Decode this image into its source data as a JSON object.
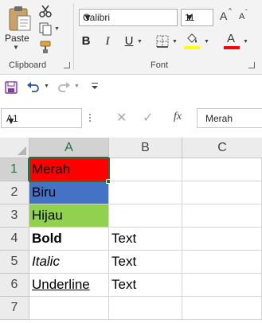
{
  "ribbon": {
    "clipboard": {
      "paste_label": "Paste",
      "group_label": "Clipboard",
      "icons": [
        "clipboard-paste-icon",
        "cut-icon",
        "copy-icon",
        "format-painter-icon"
      ]
    },
    "font": {
      "group_label": "Font",
      "font_name": "Calibri",
      "font_size": "11",
      "grow_label": "A",
      "shrink_label": "A",
      "bold_label": "B",
      "italic_label": "I",
      "underline_label": "U",
      "fill_color": "#ffff00",
      "font_color": "#ff0000",
      "icons": [
        "borders-icon",
        "fill-color-icon",
        "font-color-icon"
      ]
    }
  },
  "qat": {
    "icons": [
      "save-icon",
      "undo-icon",
      "redo-icon",
      "customize-qat-icon"
    ]
  },
  "formula_bar": {
    "name_box": "A1",
    "fx_label": "fx",
    "formula": "Merah",
    "icons": [
      "cancel-icon",
      "enter-icon",
      "insert-function-icon"
    ]
  },
  "sheet": {
    "columns": [
      "A",
      "B",
      "C"
    ],
    "rows": [
      "1",
      "2",
      "3",
      "4",
      "5",
      "6",
      "7"
    ],
    "selected_cell": "A1",
    "cells": {
      "A1": {
        "text": "Merah",
        "fill": "#ff0000"
      },
      "A2": {
        "text": "Biru",
        "fill": "#4472c4"
      },
      "A3": {
        "text": "Hijau",
        "fill": "#92d050"
      },
      "A4": {
        "text": "Bold",
        "style": "bold"
      },
      "B4": {
        "text": "Text"
      },
      "A5": {
        "text": "Italic",
        "style": "italic"
      },
      "B5": {
        "text": "Text"
      },
      "A6": {
        "text": "Underline",
        "style": "underline"
      },
      "B6": {
        "text": "Text"
      }
    }
  },
  "colors": {
    "accent": "#217346",
    "ribbon_bg": "#f3f3f3",
    "header_bg": "#ececec",
    "selected_header_bg": "#d2d2d2"
  }
}
